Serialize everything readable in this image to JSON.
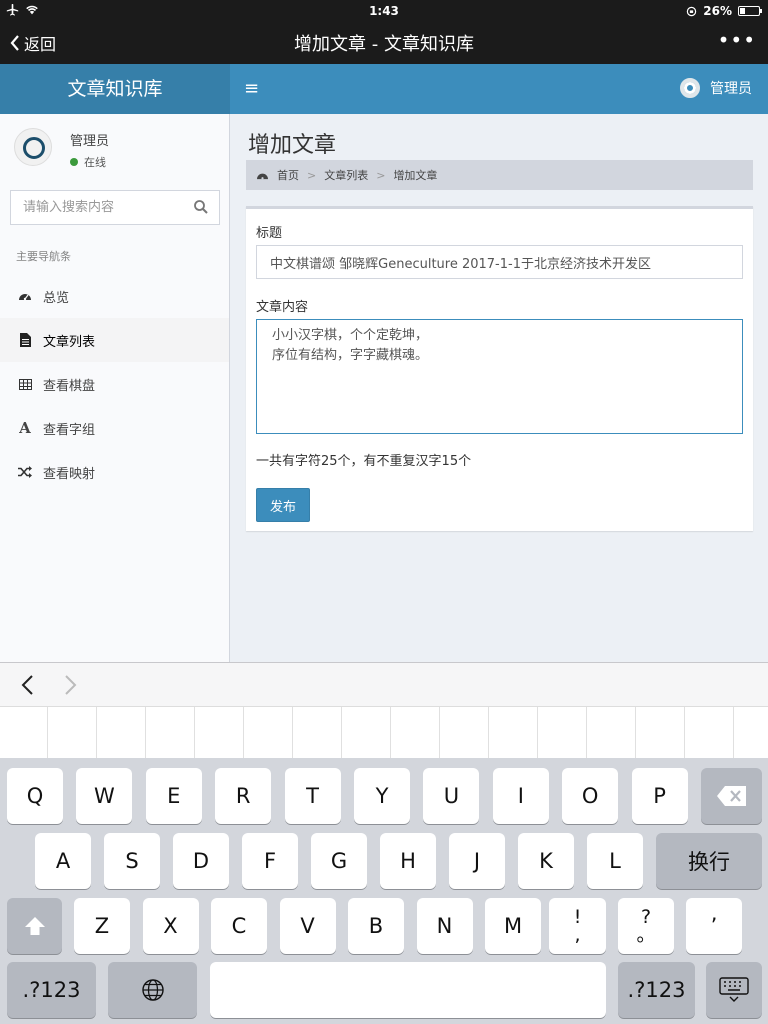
{
  "status_bar": {
    "time": "1:43",
    "battery": "26%"
  },
  "nav": {
    "back_label": "返回",
    "title": "增加文章 - 文章知识库",
    "more": "•••"
  },
  "app": {
    "logo": "文章知识库",
    "menu_icon": "≡",
    "user": "管理员"
  },
  "sidebar": {
    "user_name": "管理员",
    "user_status": "在线",
    "search_placeholder": "请输入搜索内容",
    "nav_header": "主要导航条",
    "items": [
      {
        "label": "总览",
        "icon": "dashboard-icon"
      },
      {
        "label": "文章列表",
        "icon": "file-icon"
      },
      {
        "label": "查看棋盘",
        "icon": "grid-icon"
      },
      {
        "label": "查看字组",
        "icon": "font-icon"
      },
      {
        "label": "查看映射",
        "icon": "shuffle-icon"
      }
    ]
  },
  "content": {
    "page_title": "增加文章",
    "breadcrumb": [
      "首页",
      "文章列表",
      "增加文章"
    ],
    "title_label": "标题",
    "title_value": "中文棋谱颂 邹晓辉Geneculture 2017-1-1于北京经济技术开发区",
    "body_label": "文章内容",
    "body_value": "小小汉字棋，个个定乾坤，\n序位有结构，字字藏棋魂。",
    "char_count": "一共有字符25个，有不重复汉字15个",
    "publish": "发布"
  },
  "keyboard": {
    "row1": [
      "Q",
      "W",
      "E",
      "R",
      "T",
      "Y",
      "U",
      "I",
      "O",
      "P"
    ],
    "row2": [
      "A",
      "S",
      "D",
      "F",
      "G",
      "H",
      "J",
      "K",
      "L"
    ],
    "return": "换行",
    "row3": [
      "Z",
      "X",
      "C",
      "V",
      "B",
      "N",
      "M"
    ],
    "punct1": [
      "!",
      ","
    ],
    "punct2": [
      "?",
      "。"
    ],
    "punct3": "’",
    "numbers": ".?123"
  },
  "colors": {
    "header": "#3c8dbc",
    "logo_bg": "#367fa9",
    "status_online": "#3c9a3c"
  }
}
